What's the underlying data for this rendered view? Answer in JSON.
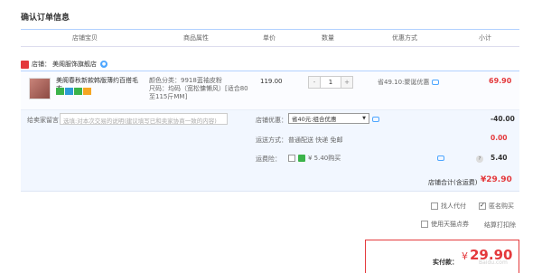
{
  "page_title": "确认订单信息",
  "table_headers": [
    "店铺宝贝",
    "商品属性",
    "单价",
    "数量",
    "优惠方式",
    "小计"
  ],
  "shop": {
    "label": "店铺：",
    "name": "美阁服饰旗舰店"
  },
  "item": {
    "name": "美阁春秋新款韩版薄约百搭毛衣...",
    "prop_color": "颜色分类：9918蓝袖皮粉",
    "prop_size": "尺码：均码（宽松慵懒风）[适合80至115斤MM]",
    "unit_price": "119.00",
    "quantity": "1",
    "qty_minus": "-",
    "qty_plus": "+",
    "promo": "省49.10:聚诞优惠",
    "subtotal": "69.90"
  },
  "message": {
    "label": "给卖家留言：",
    "placeholder": "选填:对本次交易的说明(建议填写已和卖家协商一致的内容)"
  },
  "shop_discount": {
    "label": "店铺优惠：",
    "selected": "省40元:组合优惠",
    "amount": "-40.00"
  },
  "shipping": {
    "label": "运送方式：",
    "value": "普通配送 快递 免邮",
    "amount": "0.00"
  },
  "insurance": {
    "label": "运费险：",
    "text": "¥ 5.40购买",
    "amount": "5.40"
  },
  "shop_total": {
    "label": "店铺合计(含运费)",
    "amount": "¥29.90"
  },
  "options": {
    "pay_for_other": "找人代付",
    "anonymous": "匿名购买",
    "use_points": "使用天猫点券",
    "settle": "结算打扣除"
  },
  "final": {
    "label": "实付款：",
    "currency": "¥",
    "amount": "29.90"
  },
  "watermark": "Baidu.com",
  "colors": {
    "accent_red": "#e4393c",
    "border_blue": "#b2d1ff",
    "panel_blue": "#f2f7ff"
  }
}
